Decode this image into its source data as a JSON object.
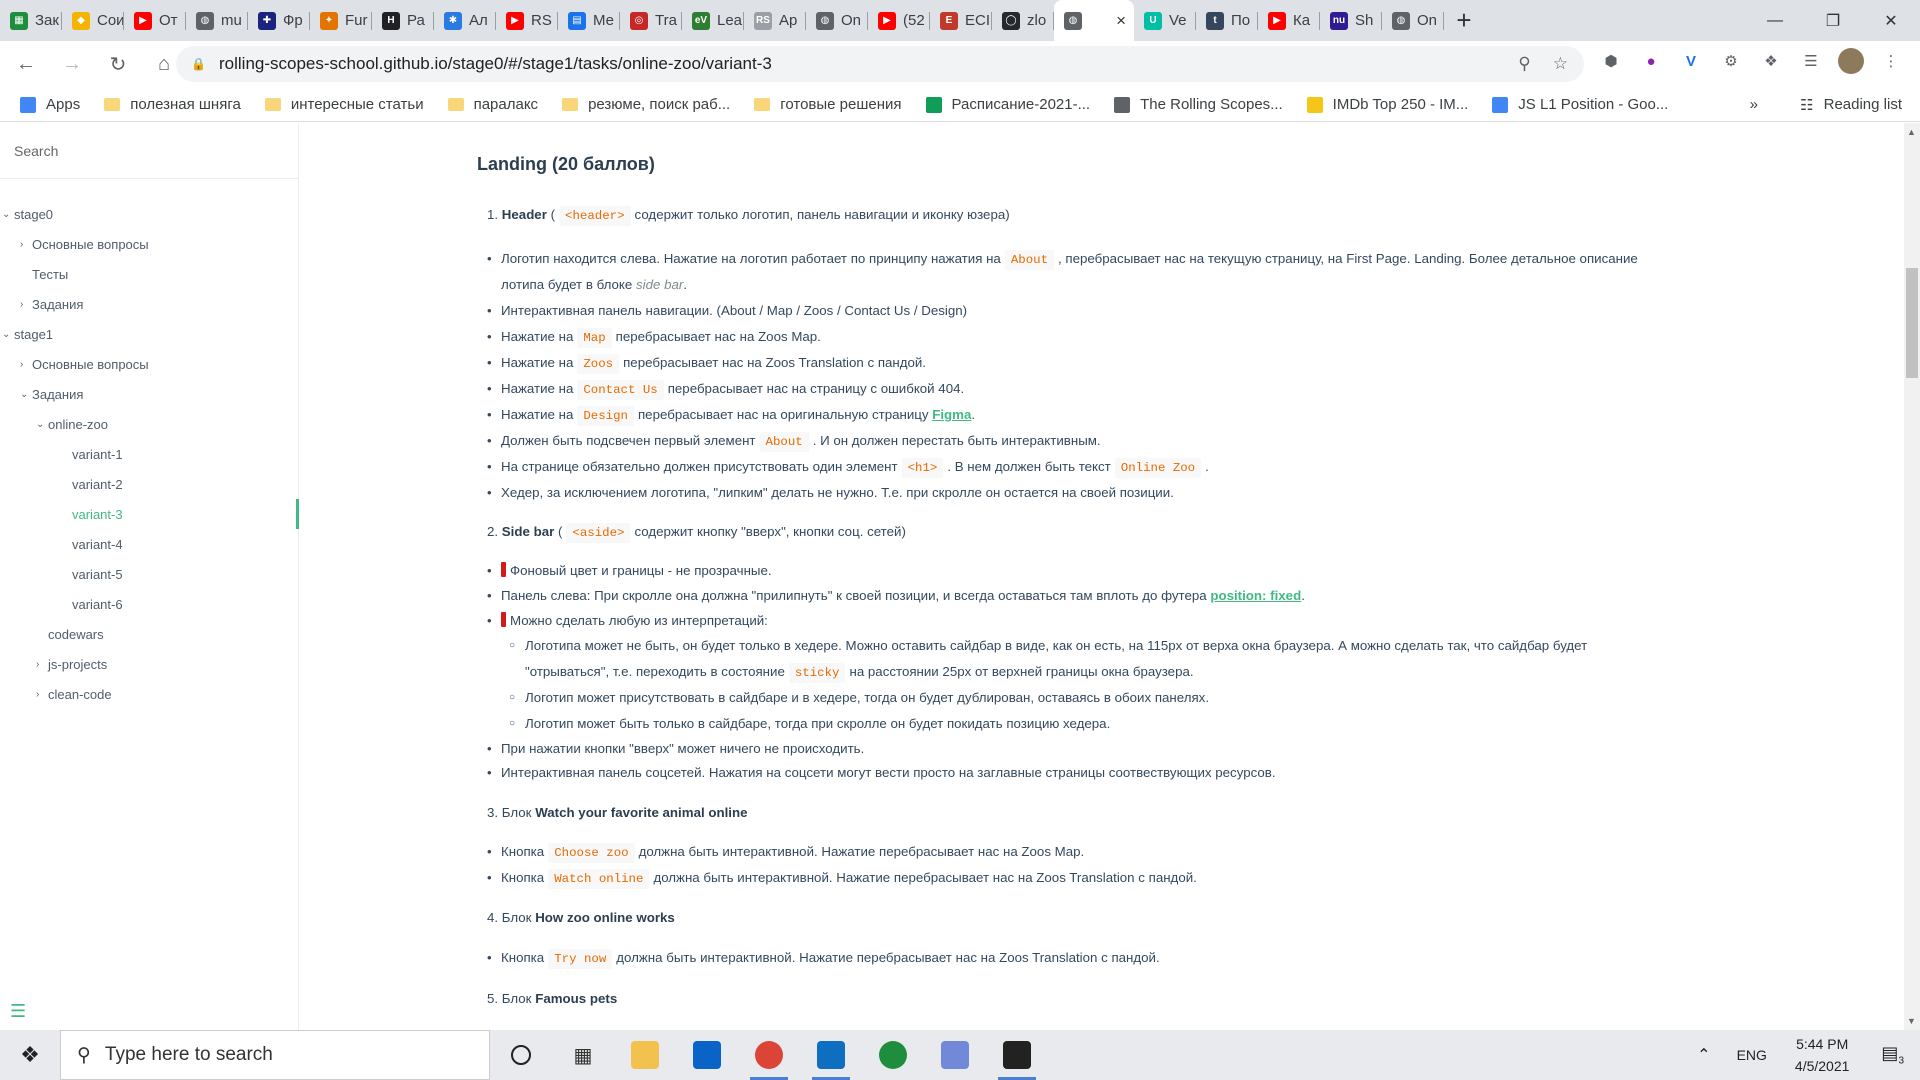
{
  "browser": {
    "tabs": [
      {
        "label": "Зак",
        "color": "#1e8e3e",
        "glyph": "▦"
      },
      {
        "label": "Сои",
        "color": "#f4b400",
        "glyph": "◆"
      },
      {
        "label": "От",
        "color": "#ff0000",
        "glyph": "▶"
      },
      {
        "label": "mu",
        "color": "#5f6368",
        "glyph": "◍"
      },
      {
        "label": "Фр",
        "color": "#1a237e",
        "glyph": "✚"
      },
      {
        "label": "Fur",
        "color": "#e37400",
        "glyph": "✦"
      },
      {
        "label": "Ра",
        "color": "#202124",
        "glyph": "H"
      },
      {
        "label": "Ал",
        "color": "#2a7ae2",
        "glyph": "✱"
      },
      {
        "label": "RS",
        "color": "#ff0000",
        "glyph": "▶"
      },
      {
        "label": "Ме",
        "color": "#1a73e8",
        "glyph": "▤"
      },
      {
        "label": "Tra",
        "color": "#c62828",
        "glyph": "◎"
      },
      {
        "label": "Lea",
        "color": "#2e7d32",
        "glyph": "eV"
      },
      {
        "label": "Ap",
        "color": "#9aa0a6",
        "glyph": "RS"
      },
      {
        "label": "On",
        "color": "#5f6368",
        "glyph": "◍"
      },
      {
        "label": "(52",
        "color": "#ff0000",
        "glyph": "▶"
      },
      {
        "label": "ECI",
        "color": "#c0392b",
        "glyph": "E"
      },
      {
        "label": "zlo",
        "color": "#24292e",
        "glyph": "◯"
      },
      {
        "label": "",
        "color": "#5f6368",
        "glyph": "◍",
        "active": true
      },
      {
        "label": "Ve",
        "color": "#00bfa5",
        "glyph": "U"
      },
      {
        "label": "По",
        "color": "#36465d",
        "glyph": "t"
      },
      {
        "label": "Ка",
        "color": "#ff0000",
        "glyph": "▶"
      },
      {
        "label": "Sh",
        "color": "#311b92",
        "glyph": "nu"
      },
      {
        "label": "On",
        "color": "#5f6368",
        "glyph": "◍"
      }
    ],
    "url": "rolling-scopes-school.github.io/stage0/#/stage1/tasks/online-zoo/variant-3",
    "bookmarks": [
      {
        "label": "Apps",
        "type": "apps"
      },
      {
        "label": "полезная шняга",
        "type": "folder"
      },
      {
        "label": "интересные статьи",
        "type": "folder"
      },
      {
        "label": "паралакс",
        "type": "folder"
      },
      {
        "label": "резюме, поиск раб...",
        "type": "folder"
      },
      {
        "label": "готовые решения",
        "type": "folder"
      },
      {
        "label": "Расписание-2021-...",
        "type": "sheet"
      },
      {
        "label": "The Rolling Scopes...",
        "type": "globe"
      },
      {
        "label": "IMDb Top 250 - IM...",
        "type": "imdb"
      },
      {
        "label": "JS L1 Position - Goo...",
        "type": "doc"
      }
    ],
    "bookmarks_more": "»",
    "reading_list": "Reading list"
  },
  "sidebar": {
    "search_placeholder": "Search",
    "items": [
      {
        "label": "stage0",
        "indent": 0,
        "caret": "⌄"
      },
      {
        "label": "Основные вопросы",
        "indent": 1,
        "caret": "›"
      },
      {
        "label": "Тесты",
        "indent": 1,
        "caret": ""
      },
      {
        "label": "Задания",
        "indent": 1,
        "caret": "›"
      },
      {
        "label": "stage1",
        "indent": 0,
        "caret": "⌄"
      },
      {
        "label": "Основные вопросы",
        "indent": 1,
        "caret": "›"
      },
      {
        "label": "Задания",
        "indent": 1,
        "caret": "⌄"
      },
      {
        "label": "online-zoo",
        "indent": 2,
        "caret": "⌄"
      },
      {
        "label": "variant-1",
        "indent": 3,
        "caret": ""
      },
      {
        "label": "variant-2",
        "indent": 3,
        "caret": ""
      },
      {
        "label": "variant-3",
        "indent": 3,
        "caret": "",
        "active": true
      },
      {
        "label": "variant-4",
        "indent": 3,
        "caret": ""
      },
      {
        "label": "variant-5",
        "indent": 3,
        "caret": ""
      },
      {
        "label": "variant-6",
        "indent": 3,
        "caret": ""
      },
      {
        "label": "codewars",
        "indent": 2,
        "caret": ""
      },
      {
        "label": "js-projects",
        "indent": 2,
        "caret": "›"
      },
      {
        "label": "clean-code",
        "indent": 2,
        "caret": "›"
      }
    ]
  },
  "article": {
    "heading": "Landing (20 баллов)",
    "s1_num": "1.",
    "s1_title": "Header",
    "s1_open": "(",
    "s1_code": "<header>",
    "s1_rest": "содержит только логотип, панель навигации и иконку юзера)",
    "b1a": "Логотип находится слева. Нажатие на логотип работает по принципу нажатия на",
    "b1a_code": "About",
    "b1a_rest": ", перебрасывает нас на текущую страницу, на First Page. Landing. Более детальное описание",
    "b1a_cont": "лотипа будет в блоке",
    "b1a_em": "side bar",
    "b1a_end": ".",
    "b2": "Интерактивная панель навигации. (About / Map / Zoos / Contact Us / Design)",
    "b3_pre": "Нажатие на",
    "b3_code": "Map",
    "b3_rest": "перебрасывает нас на Zoos Map.",
    "b4_pre": "Нажатие на",
    "b4_code": "Zoos",
    "b4_rest": "перебрасывает нас на Zoos Translation с пандой.",
    "b5_pre": "Нажатие на",
    "b5_code": "Contact Us",
    "b5_rest": "перебрасывает нас на страницу с ошибкой 404.",
    "b6_pre": "Нажатие на",
    "b6_code": "Design",
    "b6_rest": "перебрасывает нас на оригинальную страницу",
    "b6_link": "Figma",
    "b6_end": ".",
    "b7_pre": "Должен быть подсвечен первый элемент",
    "b7_code": "About",
    "b7_rest": ". И он должен перестать быть интерактивным.",
    "b8_pre": "На странице обязательно должен присутствовать один элемент",
    "b8_code": "<h1>",
    "b8_mid": ". В нем должен быть текст",
    "b8_code2": "Online Zoo",
    "b8_end": ".",
    "b9": "Хедер, за исключением логотипа, \"липким\" делать не нужно. Т.е. при скролле он остается на своей позиции.",
    "s2_num": "2.",
    "s2_title": "Side bar",
    "s2_open": "(",
    "s2_code": "<aside>",
    "s2_rest": "содержит кнопку \"вверх\", кнопки соц. сетей)",
    "c1": "Фоновый цвет и границы - не прозрачные.",
    "c2": "Панель слева: При скролле она должна \"прилипнуть\" к своей позиции, и всегда оставаться там вплоть до футера",
    "c2_link": "position: fixed",
    "c2_end": ".",
    "c3": "Можно сделать любую из интерпретаций:",
    "c3a": "Логотипа может не быть, он будет только в хедере. Можно оставить сайдбар в виде, как он есть, на 115px от верха окна браузера. А можно сделать так, что сайдбар будет",
    "c3a_cont": "\"отрываться\", т.е. переходить в состояние",
    "c3a_code": "sticky",
    "c3a_end": "на расстоянии 25px от верхней границы окна браузера.",
    "c3b": "Логотип может присутствовать в сайдбаре и в хедере, тогда он будет дублирован, оставаясь в обоих панелях.",
    "c3c": "Логотип может быть только в сайдбаре, тогда при скролле он будет покидать позицию хедера.",
    "c4": "При нажатии кнопки \"вверх\" может ничего не происходить.",
    "c5": "Интерактивная панель соцсетей. Нажатия на соцсети могут вести просто на заглавные страницы соотвествующих ресурсов.",
    "s3_num": "3.",
    "s3_pre": "Блок",
    "s3_title": "Watch your favorite animal online",
    "d1_pre": "Кнопка",
    "d1_code": "Choose zoo",
    "d1_rest": "должна быть интерактивной. Нажатие перебрасывает нас на Zoos Map.",
    "d2_pre": "Кнопка",
    "d2_code": "Watch online",
    "d2_rest": "должна быть интерактивной. Нажатие перебрасывает нас на Zoos Translation с пандой.",
    "s4_num": "4.",
    "s4_pre": "Блок",
    "s4_title": "How zoo online works",
    "e1_pre": "Кнопка",
    "e1_code": "Try now",
    "e1_rest": "должна быть интерактивной. Нажатие перебрасывает нас на Zoos Translation с пандой.",
    "s5_num": "5.",
    "s5_pre": "Блок",
    "s5_title": "Famous pets"
  },
  "taskbar": {
    "search_placeholder": "Type here to search",
    "lang": "ENG",
    "time": "5:44 PM",
    "date": "4/5/2021",
    "notif_count": "3"
  },
  "colors": {
    "accent": "#42b983",
    "code": "#e96900"
  }
}
